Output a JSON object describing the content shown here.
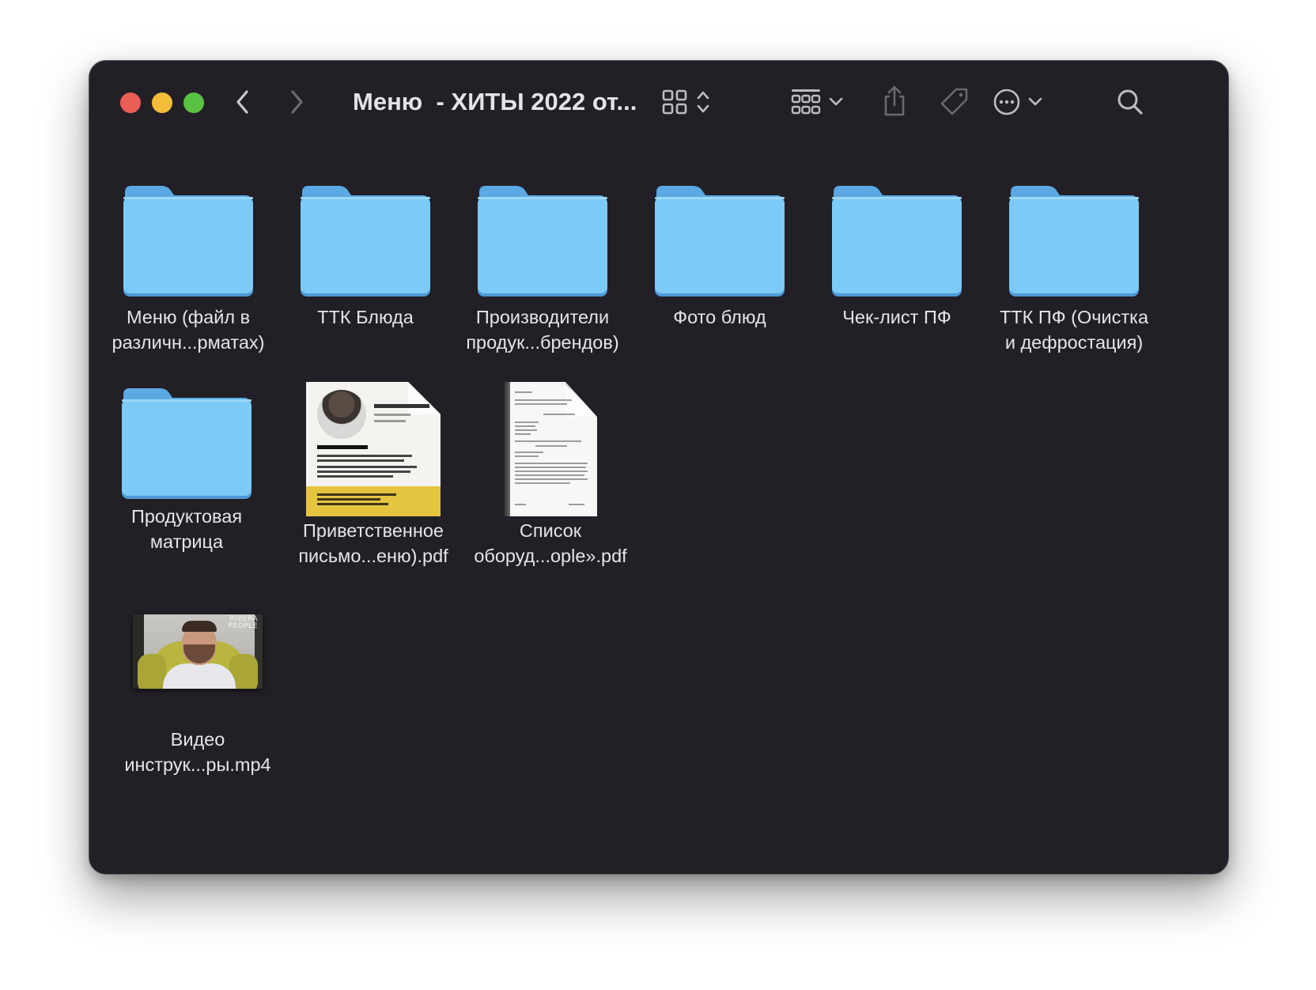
{
  "window": {
    "title": "Меню  - ХИТЫ 2022 от...",
    "controls": [
      "close",
      "minimize",
      "zoom"
    ],
    "toolbar_icons": [
      "back-icon",
      "forward-icon",
      "icon-view-icon",
      "group-by-icon",
      "share-icon",
      "tag-icon",
      "more-actions-icon",
      "search-icon"
    ]
  },
  "items": [
    {
      "type": "folder",
      "label_line1": "Меню (файл в",
      "label_line2": "различн...рматах)"
    },
    {
      "type": "folder",
      "label_line1": "ТТК Блюда",
      "label_line2": ""
    },
    {
      "type": "folder",
      "label_line1": "Производители",
      "label_line2": "продук...брендов)"
    },
    {
      "type": "folder",
      "label_line1": "Фото блюд",
      "label_line2": ""
    },
    {
      "type": "folder",
      "label_line1": "Чек-лист ПФ",
      "label_line2": ""
    },
    {
      "type": "folder",
      "label_line1": "ТТК ПФ (Очистка",
      "label_line2": "и дефростация)"
    },
    {
      "type": "folder",
      "label_line1": "Продуктовая",
      "label_line2": "матрица"
    },
    {
      "type": "pdf",
      "label_line1": "Приветственное",
      "label_line2": "письмо...еню).pdf",
      "preview": {
        "heading": "ДОБРЫЙ ДЕНЬ!",
        "name": "Егор Ривера"
      }
    },
    {
      "type": "pdf",
      "label_line1": "Список",
      "label_line2": "оборуд...ople».pdf"
    },
    {
      "type": "video",
      "label_line1": "Видео",
      "label_line2": "инструк...ры.mp4",
      "preview": {
        "logo_line1": "RIVERA",
        "logo_line2": "PEOPLE"
      }
    }
  ],
  "colors": {
    "window_bg": "#231f27",
    "folder_body": "#7ccaf6",
    "folder_tab": "#5aa9e3",
    "text": "#e6e5e8",
    "close": "#ec5d56",
    "minimize": "#f3bd3a",
    "zoom": "#5ac242"
  }
}
